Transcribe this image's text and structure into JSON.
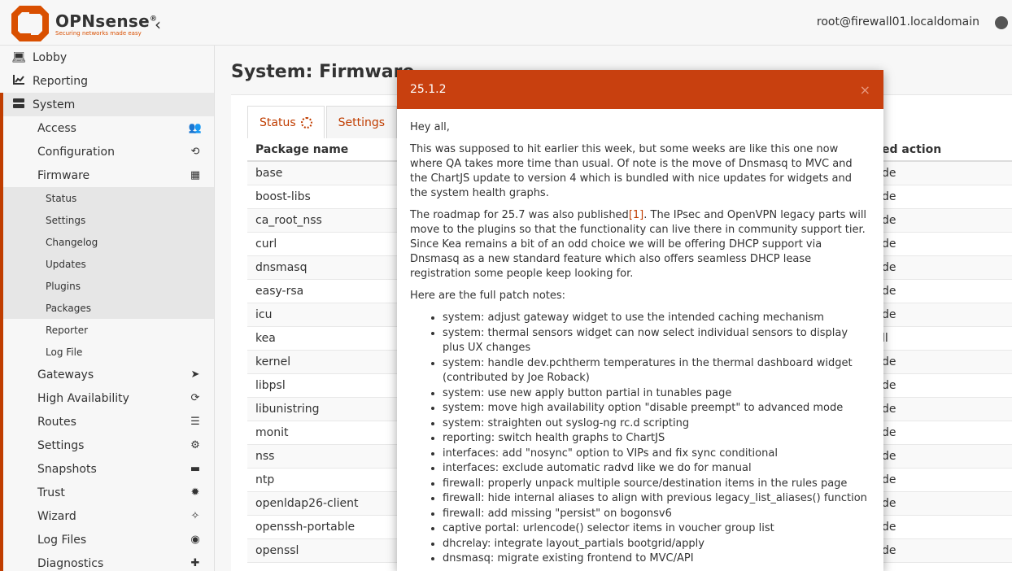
{
  "header": {
    "logo_name": "OPNsense",
    "logo_reg": "®",
    "logo_tagline": "Securing networks made easy",
    "collapse_icon": "‹",
    "user": "root@firewall01.localdomain"
  },
  "sidebar": {
    "top": [
      {
        "label": "Lobby",
        "icon": "laptop-icon"
      },
      {
        "label": "Reporting",
        "icon": "chart-icon"
      },
      {
        "label": "System",
        "icon": "server-icon"
      }
    ],
    "system_items": [
      {
        "label": "Access",
        "icon": "users-icon",
        "glyph": "👥"
      },
      {
        "label": "Configuration",
        "icon": "history-icon",
        "glyph": "⟲"
      },
      {
        "label": "Firmware",
        "icon": "building-icon",
        "glyph": "▦"
      }
    ],
    "firmware_items": [
      "Status",
      "Settings",
      "Changelog",
      "Updates",
      "Plugins",
      "Packages",
      "Reporter",
      "Log File"
    ],
    "system_items_after": [
      {
        "label": "Gateways",
        "icon": "location-arrow-icon",
        "glyph": "➤"
      },
      {
        "label": "High Availability",
        "icon": "refresh-icon",
        "glyph": "⟳"
      },
      {
        "label": "Routes",
        "icon": "routes-icon",
        "glyph": "☰"
      },
      {
        "label": "Settings",
        "icon": "cogs-icon",
        "glyph": "⚙"
      },
      {
        "label": "Snapshots",
        "icon": "hdd-icon",
        "glyph": "▬"
      },
      {
        "label": "Trust",
        "icon": "certificate-icon",
        "glyph": "✹"
      },
      {
        "label": "Wizard",
        "icon": "magic-wand-icon",
        "glyph": "✧"
      },
      {
        "label": "Log Files",
        "icon": "eye-icon",
        "glyph": "◉"
      },
      {
        "label": "Diagnostics",
        "icon": "medkit-icon",
        "glyph": "✚"
      }
    ]
  },
  "main": {
    "title": "System: Firmware",
    "tabs": {
      "status": "Status",
      "settings": "Settings"
    },
    "table": {
      "col_name": "Package name",
      "col_action": "ed action",
      "rows": [
        {
          "name": "base",
          "action": "de"
        },
        {
          "name": "boost-libs",
          "action": "de"
        },
        {
          "name": "ca_root_nss",
          "action": "de"
        },
        {
          "name": "curl",
          "action": "de"
        },
        {
          "name": "dnsmasq",
          "action": "de"
        },
        {
          "name": "easy-rsa",
          "action": "de"
        },
        {
          "name": "icu",
          "action": "de"
        },
        {
          "name": "kea",
          "action": "ll"
        },
        {
          "name": "kernel",
          "action": "de"
        },
        {
          "name": "libpsl",
          "action": "de"
        },
        {
          "name": "libunistring",
          "action": "de"
        },
        {
          "name": "monit",
          "action": "de"
        },
        {
          "name": "nss",
          "action": "de"
        },
        {
          "name": "ntp",
          "action": "de"
        },
        {
          "name": "openldap26-client",
          "action": "de"
        },
        {
          "name": "openssh-portable",
          "action": "de"
        },
        {
          "name": "openssl",
          "action": "de"
        }
      ]
    }
  },
  "modal": {
    "title": "25.1.2",
    "close": "×",
    "greeting": "Hey all,",
    "para1": "This was supposed to hit earlier this week, but some weeks are like this one now where QA takes more time than usual. Of note is the move of Dnsmasq to MVC and the ChartJS update to version 4 which is bundled with nice updates for widgets and the system health graphs.",
    "para2_before": "The roadmap for 25.7 was also published",
    "para2_link": "[1]",
    "para2_after": ". The IPsec and OpenVPN legacy parts will move to the plugins so that the functionality can live there in community support tier. Since Kea remains a bit of an odd choice we will be offering DHCP support via Dnsmasq as a new standard feature which also offers seamless DHCP lease registration some people keep looking for.",
    "para3": "Here are the full patch notes:",
    "notes": [
      "system: adjust gateway widget to use the intended caching mechanism",
      "system: thermal sensors widget can now select individual sensors to display plus UX changes",
      "system: handle dev.pchtherm temperatures in the thermal dashboard widget (contributed by Joe Roback)",
      "system: use new apply button partial in tunables page",
      "system: move high availability option \"disable preempt\" to advanced mode",
      "system: straighten out syslog-ng rc.d scripting",
      "reporting: switch health graphs to ChartJS",
      "interfaces: add \"nosync\" option to VIPs and fix sync conditional",
      "interfaces: exclude automatic radvd like we do for manual",
      "firewall: properly unpack multiple source/destination items in the rules page",
      "firewall: hide internal aliases to align with previous legacy_list_aliases() function",
      "firewall: add missing \"persist\" on bogonsv6",
      "captive portal: urlencode() selector items in voucher group list",
      "dhcrelay: integrate layout_partials bootgrid/apply",
      "dnsmasq: migrate existing frontend to MVC/API"
    ]
  },
  "colors": {
    "brand": "#c03d00",
    "modal_header": "#c8400f"
  }
}
